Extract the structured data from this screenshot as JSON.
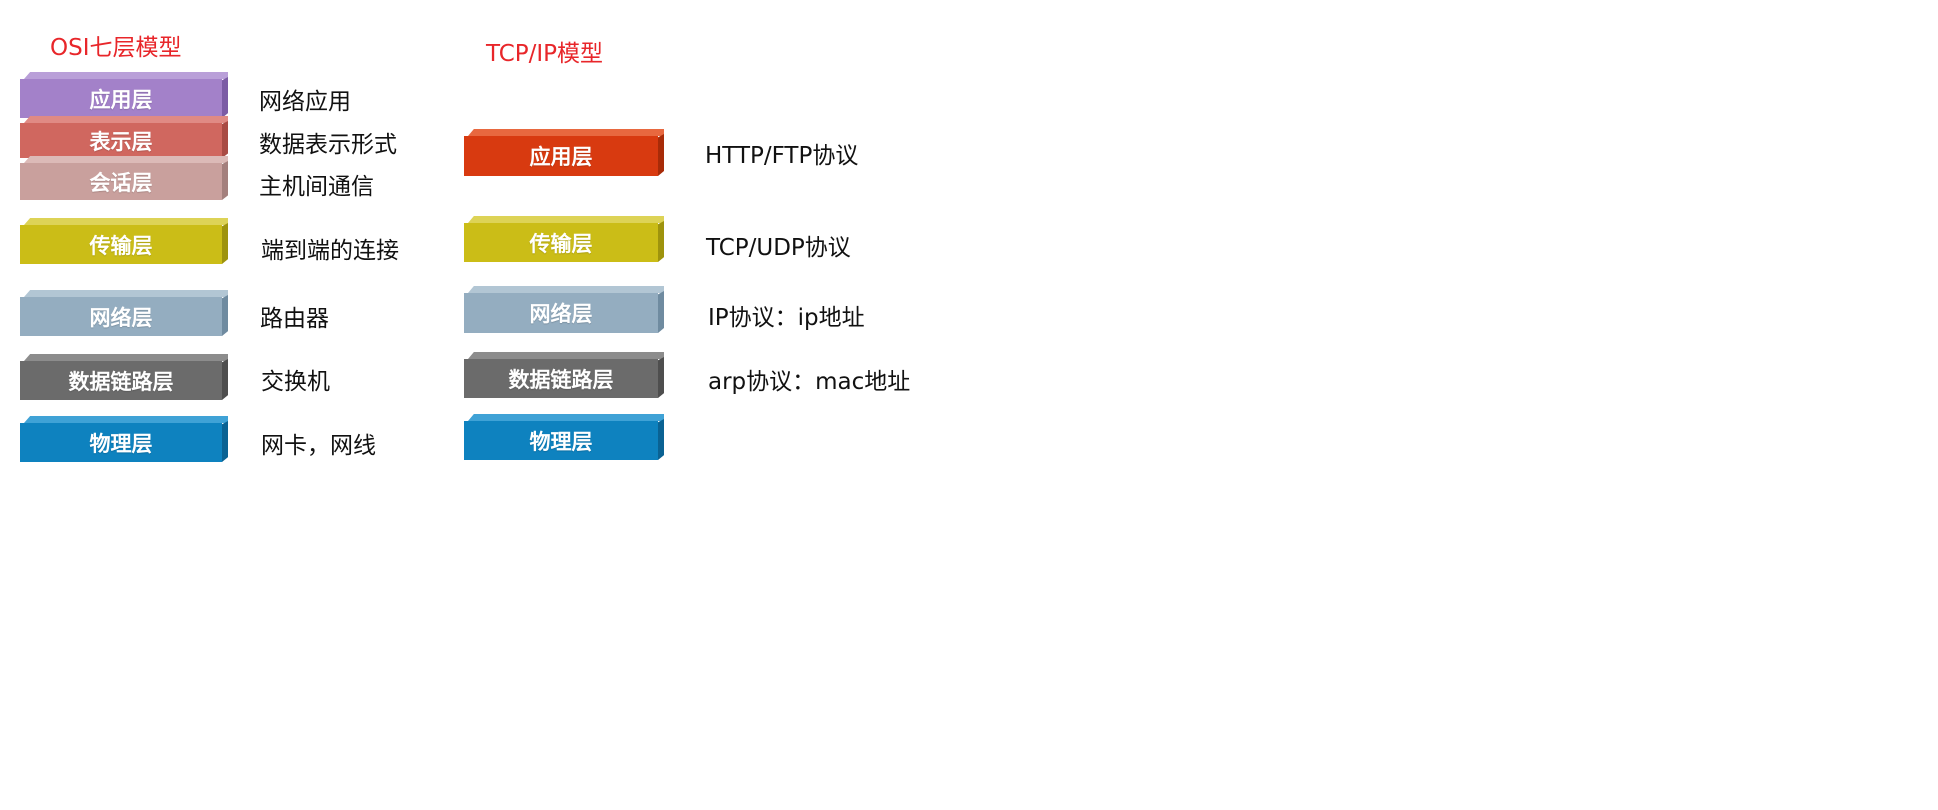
{
  "osi": {
    "title": "OSI七层模型",
    "layers": [
      {
        "label": "应用层",
        "desc": "网络应用",
        "face": "#a381c9",
        "top": "#b99fd8",
        "side": "#7c5ca5"
      },
      {
        "label": "表示层",
        "desc": "数据表示形式",
        "face": "#d0675f",
        "top": "#e08a84",
        "side": "#a94b44"
      },
      {
        "label": "会话层",
        "desc": "主机间通信",
        "face": "#c9a09d",
        "top": "#dcbab7",
        "side": "#a4807d"
      },
      {
        "label": "传输层",
        "desc": "端到端的连接",
        "face": "#cbbd17",
        "top": "#ddd356",
        "side": "#9e930d"
      },
      {
        "label": "网络层",
        "desc": "路由器",
        "face": "#94adc0",
        "top": "#b2c6d4",
        "side": "#6f8ba0"
      },
      {
        "label": "数据链路层",
        "desc": "交换机",
        "face": "#6b6b6b",
        "top": "#8c8c8c",
        "side": "#4e4e4e"
      },
      {
        "label": "物理层",
        "desc": "网卡，网线",
        "face": "#0e82bf",
        "top": "#3fa2d6",
        "side": "#0a6293"
      }
    ]
  },
  "tcpip": {
    "title": "TCP/IP模型",
    "layers": [
      {
        "label": "应用层",
        "desc": "HTTP/FTP协议",
        "face": "#d83a10",
        "top": "#e8683f",
        "side": "#a82b08"
      },
      {
        "label": "传输层",
        "desc": "TCP/UDP协议",
        "face": "#cbbd17",
        "top": "#ddd356",
        "side": "#9e930d"
      },
      {
        "label": "网络层",
        "desc": "IP协议：ip地址",
        "face": "#94adc0",
        "top": "#b2c6d4",
        "side": "#6f8ba0"
      },
      {
        "label": "数据链路层",
        "desc": "arp协议：mac地址",
        "face": "#6b6b6b",
        "top": "#8c8c8c",
        "side": "#4e4e4e"
      },
      {
        "label": "物理层",
        "desc": "",
        "face": "#0e82bf",
        "top": "#3fa2d6",
        "side": "#0a6293"
      }
    ]
  }
}
